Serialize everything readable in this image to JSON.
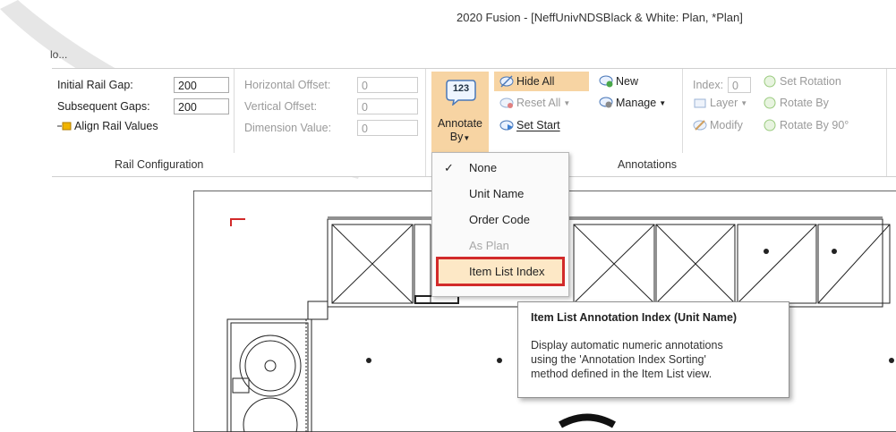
{
  "window": {
    "title": "2020 Fusion - [NeffUnivNDSBlack & White: Plan, *Plan]",
    "tab_fragment": "lo..."
  },
  "rail": {
    "initial_gap_label": "Initial Rail Gap:",
    "initial_gap_value": "200",
    "subsequent_gaps_label": "Subsequent Gaps:",
    "subsequent_gaps_value": "200",
    "align_label": "Align Rail Values",
    "horizontal_offset_label": "Horizontal Offset:",
    "horizontal_offset_value": "0",
    "vertical_offset_label": "Vertical Offset:",
    "vertical_offset_value": "0",
    "dimension_value_label": "Dimension Value:",
    "dimension_value_value": "0",
    "group_label": "Rail Configuration"
  },
  "annotations": {
    "annotate_by_line1": "Annotate",
    "annotate_by_line2": "By",
    "annotate_badge": "123",
    "hide_all": "Hide All",
    "reset_all": "Reset All",
    "set_start": "Set Start",
    "new": "New",
    "manage": "Manage",
    "index_label": "Index:",
    "index_value": "0",
    "layer": "Layer",
    "modify": "Modify",
    "set_rotation": "Set Rotation",
    "rotate_by": "Rotate By",
    "rotate_by_90": "Rotate By 90°",
    "group_label": "Annotations"
  },
  "menu": {
    "items": [
      {
        "label": "None",
        "checked": true,
        "enabled": true
      },
      {
        "label": "Unit Name",
        "checked": false,
        "enabled": true
      },
      {
        "label": "Order Code",
        "checked": false,
        "enabled": true
      },
      {
        "label": "As Plan",
        "checked": false,
        "enabled": false
      },
      {
        "label": "Item List Index",
        "checked": false,
        "enabled": true,
        "highlighted": true
      }
    ],
    "check_glyph": "✓"
  },
  "tooltip": {
    "title": "Item List Annotation Index (Unit Name)",
    "body_lines": [
      "Display automatic numeric annotations",
      "using the 'Annotation Index Sorting'",
      "method defined in the Item List view."
    ]
  },
  "colors": {
    "highlight": "#f7d4a3",
    "callout_red": "#d22a2a",
    "accent_blue": "#3b7fd4",
    "accent_green": "#4aa84a"
  }
}
